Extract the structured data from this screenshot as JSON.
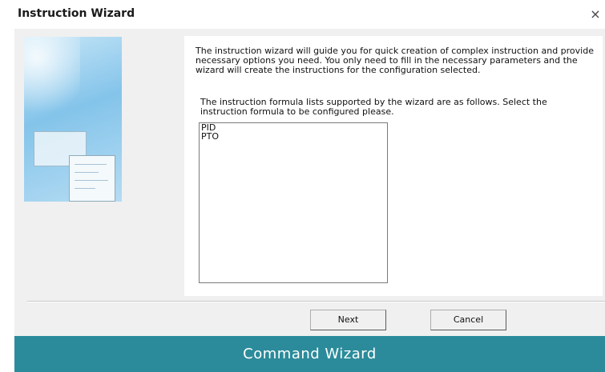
{
  "window": {
    "title": "Instruction Wizard",
    "close_glyph": "×"
  },
  "wizard": {
    "intro_text": "The instruction wizard will guide you for quick creation of complex instruction and provide necessary options you need. You only need to fill in the necessary parameters and the wizard will create the instructions for the configuration selected.",
    "prompt_text": "The instruction formula lists supported by the wizard are as follows. Select the instruction formula to be configured please.",
    "formulas": [
      "PID",
      "PTO"
    ]
  },
  "buttons": {
    "next_label": "Next",
    "cancel_label": "Cancel"
  },
  "caption": {
    "text": "Command Wizard",
    "color": "#2b8b9a"
  }
}
